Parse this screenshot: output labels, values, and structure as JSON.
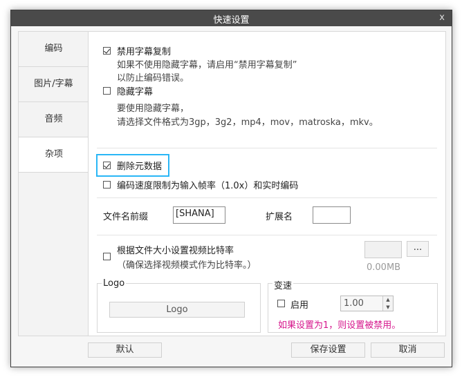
{
  "window": {
    "title": "快速设置",
    "close_label": "x"
  },
  "sidebar": {
    "tabs": [
      {
        "label": "编码"
      },
      {
        "label": "图片/字幕"
      },
      {
        "label": "音频"
      },
      {
        "label": "杂项"
      }
    ],
    "active_index": 3
  },
  "subtitles": {
    "disable_copy": {
      "label": "禁用字幕复制",
      "checked": true
    },
    "hint1": "如果不使用隐藏字幕，请启用“禁用字幕复制”",
    "hint2": "以防止编码错误。",
    "hide_subs": {
      "label": "隐藏字幕",
      "checked": false
    },
    "hint3": "要使用隐藏字幕，",
    "hint4": "请选择文件格式为3gp，3g2，mp4，mov，matroska，mkv。"
  },
  "metadata": {
    "remove_metadata": {
      "label": "删除元数据",
      "checked": true
    },
    "speed_limit": {
      "label": "编码速度限制为输入帧率（1.0x）和实时编码",
      "checked": false
    }
  },
  "filename": {
    "prefix_label": "文件名前缀",
    "prefix_value": "[SHANA]",
    "ext_label": "扩展名",
    "ext_value": ""
  },
  "bitrate": {
    "label": "根据文件大小设置视频比特率",
    "sublabel": "（确保选择视频模式作为比特率。）",
    "checked": false,
    "size_value": "",
    "browse_label": "...",
    "size_text": "0.00MB"
  },
  "logo": {
    "group_title": "Logo",
    "button_label": "Logo"
  },
  "speed": {
    "group_title": "变速",
    "enable_label": "启用",
    "enabled": false,
    "value": "1.00",
    "warning": "如果设置为1，则设置被禁用。"
  },
  "footer": {
    "default_label": "默认",
    "save_label": "保存设置",
    "cancel_label": "取消"
  },
  "colors": {
    "accent": "#29b6f6",
    "warning": "#d6168c",
    "titlebar": "#4a4a4a"
  }
}
